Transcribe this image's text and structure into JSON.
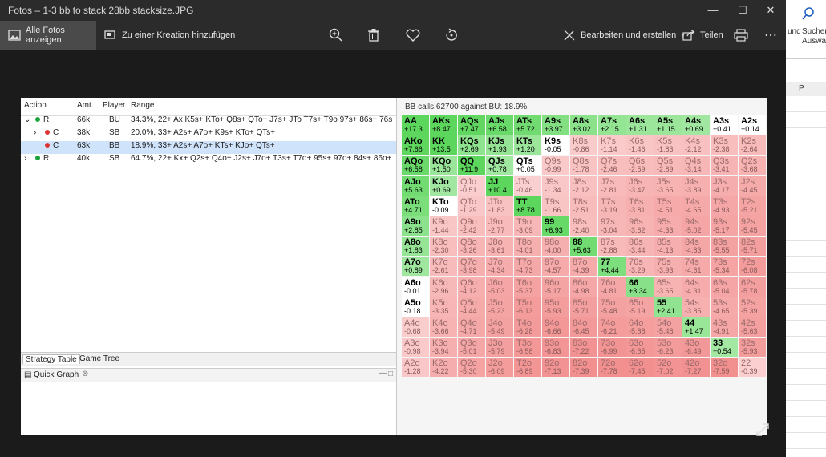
{
  "window": {
    "title": "Fotos – 1-3 bb to stack 28bb stacksize.JPG"
  },
  "toolbar": {
    "all_photos": "Alle Fotos anzeigen",
    "add_creation": "Zu einer Kreation hinzufügen",
    "edit_create": "Bearbeiten und erstellen",
    "share": "Teilen"
  },
  "excel": {
    "und": "und",
    "suchen": "Suchen",
    "auswahl": "Auswähl",
    "col_p": "P"
  },
  "tree": {
    "headers": {
      "action": "Action",
      "amt": "Amt.",
      "player": "Player",
      "range": "Range"
    },
    "rows": [
      {
        "expander": "⌄",
        "dot": "#1aa33b",
        "action": "R",
        "amt": "66k",
        "player": "BU",
        "range": "34.3%, 22+ Ax K5s+ KTo+ Q8s+ QTo+ J7s+ JTo T7s+ T9o 97s+ 86s+ 76s 65s"
      },
      {
        "expander": "›",
        "dot": "#d33",
        "action": "C",
        "amt": "38k",
        "player": "SB",
        "range": "20.0%, 33+ A2s+ A7o+ K9s+ KTo+ QTs+"
      },
      {
        "expander": "",
        "dot": "#d33",
        "action": "C",
        "amt": "63k",
        "player": "BB",
        "range": "18.9%, 33+ A2s+ A7o+ KTs+ KJo+ QTs+"
      },
      {
        "expander": "›",
        "dot": "#1aa33b",
        "action": "R",
        "amt": "40k",
        "player": "SB",
        "range": "64.7%, 22+ Kx+ Q2s+ Q4o+ J2s+ J7o+ T3s+ T7o+ 95s+ 97o+ 84s+ 86o+ 74"
      }
    ]
  },
  "tabs": {
    "strategy": "Strategy Table",
    "game_tree": "Game Tree",
    "quick_graph": "Quick Graph"
  },
  "matrix": {
    "title": "BB calls 62700 against BU: 18.9%",
    "colors": {
      "green_dark": "#5cd65c",
      "green_light": "#a7e9a7",
      "red_light": "#fbd3d3",
      "red_dark": "#f28f8f",
      "neutral": "#ffffff"
    },
    "cells": [
      [
        [
          "AA",
          "+17.3"
        ],
        [
          "AKs",
          "+8.47"
        ],
        [
          "AQs",
          "+7.47"
        ],
        [
          "AJs",
          "+6.58"
        ],
        [
          "ATs",
          "+5.72"
        ],
        [
          "A9s",
          "+3.97"
        ],
        [
          "A8s",
          "+3.02"
        ],
        [
          "A7s",
          "+2.15"
        ],
        [
          "A6s",
          "+1.31"
        ],
        [
          "A5s",
          "+1.15"
        ],
        [
          "A4s",
          "+0.69"
        ],
        [
          "A3s",
          "+0.41"
        ],
        [
          "A2s",
          "+0.14"
        ]
      ],
      [
        [
          "AKo",
          "+7.66"
        ],
        [
          "KK",
          "+13.5"
        ],
        [
          "KQs",
          "+2.69"
        ],
        [
          "KJs",
          "+1.93"
        ],
        [
          "KTs",
          "+1.20"
        ],
        [
          "K9s",
          "-0.05"
        ],
        [
          "K8s",
          "-0.86"
        ],
        [
          "K7s",
          "-1.14"
        ],
        [
          "K6s",
          "-1.46"
        ],
        [
          "K5s",
          "-1.83"
        ],
        [
          "K4s",
          "-2.12"
        ],
        [
          "K3s",
          "-2.38"
        ],
        [
          "K2s",
          "-2.64"
        ]
      ],
      [
        [
          "AQo",
          "+6.58"
        ],
        [
          "KQo",
          "+1.50"
        ],
        [
          "QQ",
          "+11.9"
        ],
        [
          "QJs",
          "+0.78"
        ],
        [
          "QTs",
          "+0.05"
        ],
        [
          "Q9s",
          "-0.99"
        ],
        [
          "Q8s",
          "-1.78"
        ],
        [
          "Q7s",
          "-2.46"
        ],
        [
          "Q6s",
          "-2.59"
        ],
        [
          "Q5s",
          "-2.89"
        ],
        [
          "Q4s",
          "-3.14"
        ],
        [
          "Q3s",
          "-3.41"
        ],
        [
          "Q2s",
          "-3.68"
        ]
      ],
      [
        [
          "AJo",
          "+5.63"
        ],
        [
          "KJo",
          "+0.69"
        ],
        [
          "QJo",
          "-0.51"
        ],
        [
          "JJ",
          "+10.4"
        ],
        [
          "JTs",
          "-0.46"
        ],
        [
          "J9s",
          "-1.34"
        ],
        [
          "J8s",
          "-2.12"
        ],
        [
          "J7s",
          "-2.81"
        ],
        [
          "J6s",
          "-3.47"
        ],
        [
          "J5s",
          "-3.65"
        ],
        [
          "J4s",
          "-3.89"
        ],
        [
          "J3s",
          "-4.17"
        ],
        [
          "J2s",
          "-4.45"
        ]
      ],
      [
        [
          "ATo",
          "+4.71"
        ],
        [
          "KTo",
          "-0.09"
        ],
        [
          "QTo",
          "-1.29"
        ],
        [
          "JTo",
          "-1.83"
        ],
        [
          "TT",
          "+8.78"
        ],
        [
          "T9s",
          "-1.66"
        ],
        [
          "T8s",
          "-2.51"
        ],
        [
          "T7s",
          "-3.19"
        ],
        [
          "T6s",
          "-3.81"
        ],
        [
          "T5s",
          "-4.51"
        ],
        [
          "T4s",
          "-4.65"
        ],
        [
          "T3s",
          "-4.93"
        ],
        [
          "T2s",
          "-5.21"
        ]
      ],
      [
        [
          "A9o",
          "+2.85"
        ],
        [
          "K9o",
          "-1.44"
        ],
        [
          "Q9o",
          "-2.42"
        ],
        [
          "J9o",
          "-2.77"
        ],
        [
          "T9o",
          "-3.09"
        ],
        [
          "99",
          "+6.93"
        ],
        [
          "98s",
          "-2.40"
        ],
        [
          "97s",
          "-3.04"
        ],
        [
          "96s",
          "-3.62"
        ],
        [
          "95s",
          "-4.33"
        ],
        [
          "94s",
          "-5.02"
        ],
        [
          "93s",
          "-5.17"
        ],
        [
          "92s",
          "-5.45"
        ]
      ],
      [
        [
          "A8o",
          "+1.83"
        ],
        [
          "K8o",
          "-2.30"
        ],
        [
          "Q8o",
          "-3.26"
        ],
        [
          "J8o",
          "-3.61"
        ],
        [
          "T8o",
          "-4.01"
        ],
        [
          "98o",
          "-4.00"
        ],
        [
          "88",
          "+5.63"
        ],
        [
          "87s",
          "-2.88"
        ],
        [
          "86s",
          "-3.44"
        ],
        [
          "85s",
          "-4.13"
        ],
        [
          "84s",
          "-4.83"
        ],
        [
          "83s",
          "-5.55"
        ],
        [
          "82s",
          "-5.71"
        ]
      ],
      [
        [
          "A7o",
          "+0.89"
        ],
        [
          "K7o",
          "-2.61"
        ],
        [
          "Q7o",
          "-3.98"
        ],
        [
          "J7o",
          "-4.34"
        ],
        [
          "T7o",
          "-4.73"
        ],
        [
          "97o",
          "-4.57"
        ],
        [
          "87o",
          "-4.39"
        ],
        [
          "77",
          "+4.44"
        ],
        [
          "76s",
          "-3.29"
        ],
        [
          "75s",
          "-3.93"
        ],
        [
          "74s",
          "-4.61"
        ],
        [
          "73s",
          "-5.34"
        ],
        [
          "72s",
          "-6.08"
        ]
      ],
      [
        [
          "A6o",
          "-0.01"
        ],
        [
          "K6o",
          "-2.96"
        ],
        [
          "Q6o",
          "-4.12"
        ],
        [
          "J6o",
          "-5.03"
        ],
        [
          "T6o",
          "-5.37"
        ],
        [
          "96o",
          "-5.17"
        ],
        [
          "86o",
          "-4.98"
        ],
        [
          "76o",
          "-4.81"
        ],
        [
          "66",
          "+3.34"
        ],
        [
          "65s",
          "-3.65"
        ],
        [
          "64s",
          "-4.31"
        ],
        [
          "63s",
          "-5.04"
        ],
        [
          "62s",
          "-5.78"
        ]
      ],
      [
        [
          "A5o",
          "-0.18"
        ],
        [
          "K5o",
          "-3.35"
        ],
        [
          "Q5o",
          "-4.44"
        ],
        [
          "J5o",
          "-5.23"
        ],
        [
          "T5o",
          "-6.13"
        ],
        [
          "95o",
          "-5.93"
        ],
        [
          "85o",
          "-5.71"
        ],
        [
          "75o",
          "-5.48"
        ],
        [
          "65o",
          "-5.19"
        ],
        [
          "55",
          "+2.41"
        ],
        [
          "54s",
          "-3.85"
        ],
        [
          "53s",
          "-4.65"
        ],
        [
          "52s",
          "-5.39"
        ]
      ],
      [
        [
          "A4o",
          "-0.68"
        ],
        [
          "K4o",
          "-3.66"
        ],
        [
          "Q4o",
          "-4.71"
        ],
        [
          "J4o",
          "-5.49"
        ],
        [
          "T4o",
          "-6.28"
        ],
        [
          "94o",
          "-6.66"
        ],
        [
          "84o",
          "-6.45"
        ],
        [
          "74o",
          "-6.21"
        ],
        [
          "64o",
          "-5.88"
        ],
        [
          "54o",
          "-5.48"
        ],
        [
          "44",
          "+1.47"
        ],
        [
          "43s",
          "-4.91"
        ],
        [
          "42s",
          "-5.63"
        ]
      ],
      [
        [
          "A3o",
          "-0.98"
        ],
        [
          "K3o",
          "-3.94"
        ],
        [
          "Q3o",
          "-5.01"
        ],
        [
          "J3o",
          "-5.79"
        ],
        [
          "T3o",
          "-6.58"
        ],
        [
          "93o",
          "-6.83"
        ],
        [
          "83o",
          "-7.22"
        ],
        [
          "73o",
          "-6.99"
        ],
        [
          "63o",
          "-6.65"
        ],
        [
          "53o",
          "-6.23"
        ],
        [
          "43o",
          "-6.49"
        ],
        [
          "33",
          "+0.54"
        ],
        [
          "32s",
          "-5.93"
        ]
      ],
      [
        [
          "A2o",
          "-1.28"
        ],
        [
          "K2o",
          "-4.22"
        ],
        [
          "Q2o",
          "-5.30"
        ],
        [
          "J2o",
          "-6.09"
        ],
        [
          "T2o",
          "-6.89"
        ],
        [
          "92o",
          "-7.13"
        ],
        [
          "82o",
          "-7.39"
        ],
        [
          "72o",
          "-7.78"
        ],
        [
          "62o",
          "-7.45"
        ],
        [
          "52o",
          "-7.02"
        ],
        [
          "42o",
          "-7.27"
        ],
        [
          "32o",
          "-7.59"
        ],
        [
          "22",
          "-0.39"
        ]
      ]
    ]
  }
}
